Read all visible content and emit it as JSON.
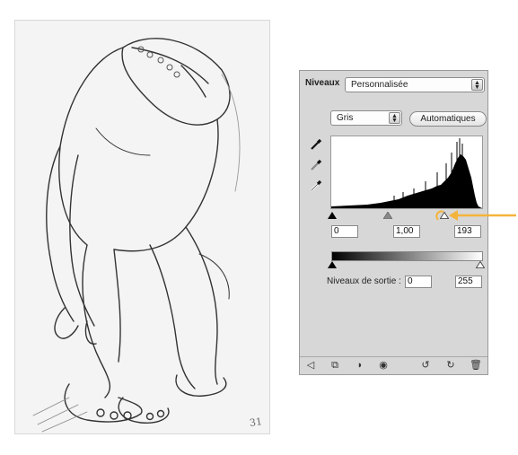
{
  "sketch": {
    "page_number": "31"
  },
  "panel": {
    "title": "Niveaux",
    "preset": "Personnalisée",
    "channel": "Gris",
    "auto_button": "Automatiques",
    "input_levels": {
      "black": "0",
      "gamma": "1,00",
      "white": "193"
    },
    "output_label": "Niveaux de sortie :",
    "output_levels": {
      "black": "0",
      "white": "255"
    }
  },
  "icons": {
    "eyedroppers": [
      "black-point-eyedropper-icon",
      "gray-point-eyedropper-icon",
      "white-point-eyedropper-icon"
    ],
    "toolbar": [
      "back-arrow-icon",
      "clip-layer-icon",
      "mask-icon",
      "visibility-eye-icon",
      "reset-icon",
      "refresh-icon",
      "trash-icon"
    ]
  },
  "colors": {
    "annotation_arrow": "#f4b43c",
    "panel_bg": "#d7d7d7"
  }
}
